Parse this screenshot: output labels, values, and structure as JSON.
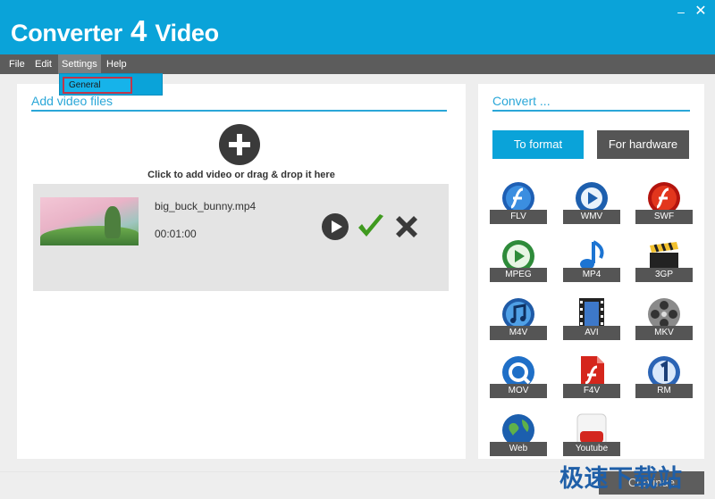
{
  "window": {
    "minimize_glyph": "–",
    "close_glyph": "✕"
  },
  "app": {
    "title_part1": "Converter",
    "title_number": "4",
    "title_part2": "Video"
  },
  "menu": {
    "items": [
      {
        "label": "File"
      },
      {
        "label": "Edit"
      },
      {
        "label": "Settings"
      },
      {
        "label": "Help"
      }
    ],
    "settings_dropdown": [
      {
        "label": "General"
      }
    ]
  },
  "left_panel": {
    "heading": "Add video files",
    "add_hint": "Click to add video or drag & drop it here",
    "video": {
      "filename": "big_buck_bunny.mp4",
      "duration": "00:01:00"
    }
  },
  "right_panel": {
    "heading": "Convert ...",
    "to_format_label": "To format",
    "for_hardware_label": "For hardware",
    "formats": [
      {
        "label": "FLV",
        "icon": "flash-globe-icon"
      },
      {
        "label": "WMV",
        "icon": "media-player-icon"
      },
      {
        "label": "SWF",
        "icon": "flash-red-icon"
      },
      {
        "label": "MPEG",
        "icon": "mpeg-play-icon"
      },
      {
        "label": "MP4",
        "icon": "music-note-icon"
      },
      {
        "label": "3GP",
        "icon": "clapper-board-icon"
      },
      {
        "label": "M4V",
        "icon": "itunes-note-icon"
      },
      {
        "label": "AVI",
        "icon": "film-strip-icon"
      },
      {
        "label": "MKV",
        "icon": "film-reel-icon"
      },
      {
        "label": "MOV",
        "icon": "quicktime-icon"
      },
      {
        "label": "F4V",
        "icon": "flash-document-icon"
      },
      {
        "label": "RM",
        "icon": "realmedia-icon"
      },
      {
        "label": "Web",
        "icon": "globe-icon"
      },
      {
        "label": "Youtube",
        "icon": "youtube-icon"
      }
    ]
  },
  "footer": {
    "continue_label": "Continue",
    "watermark": "极速下载站"
  },
  "colors": {
    "accent": "#0aa3d9",
    "menubar": "#5c5c5c",
    "dark_button": "#555555"
  }
}
